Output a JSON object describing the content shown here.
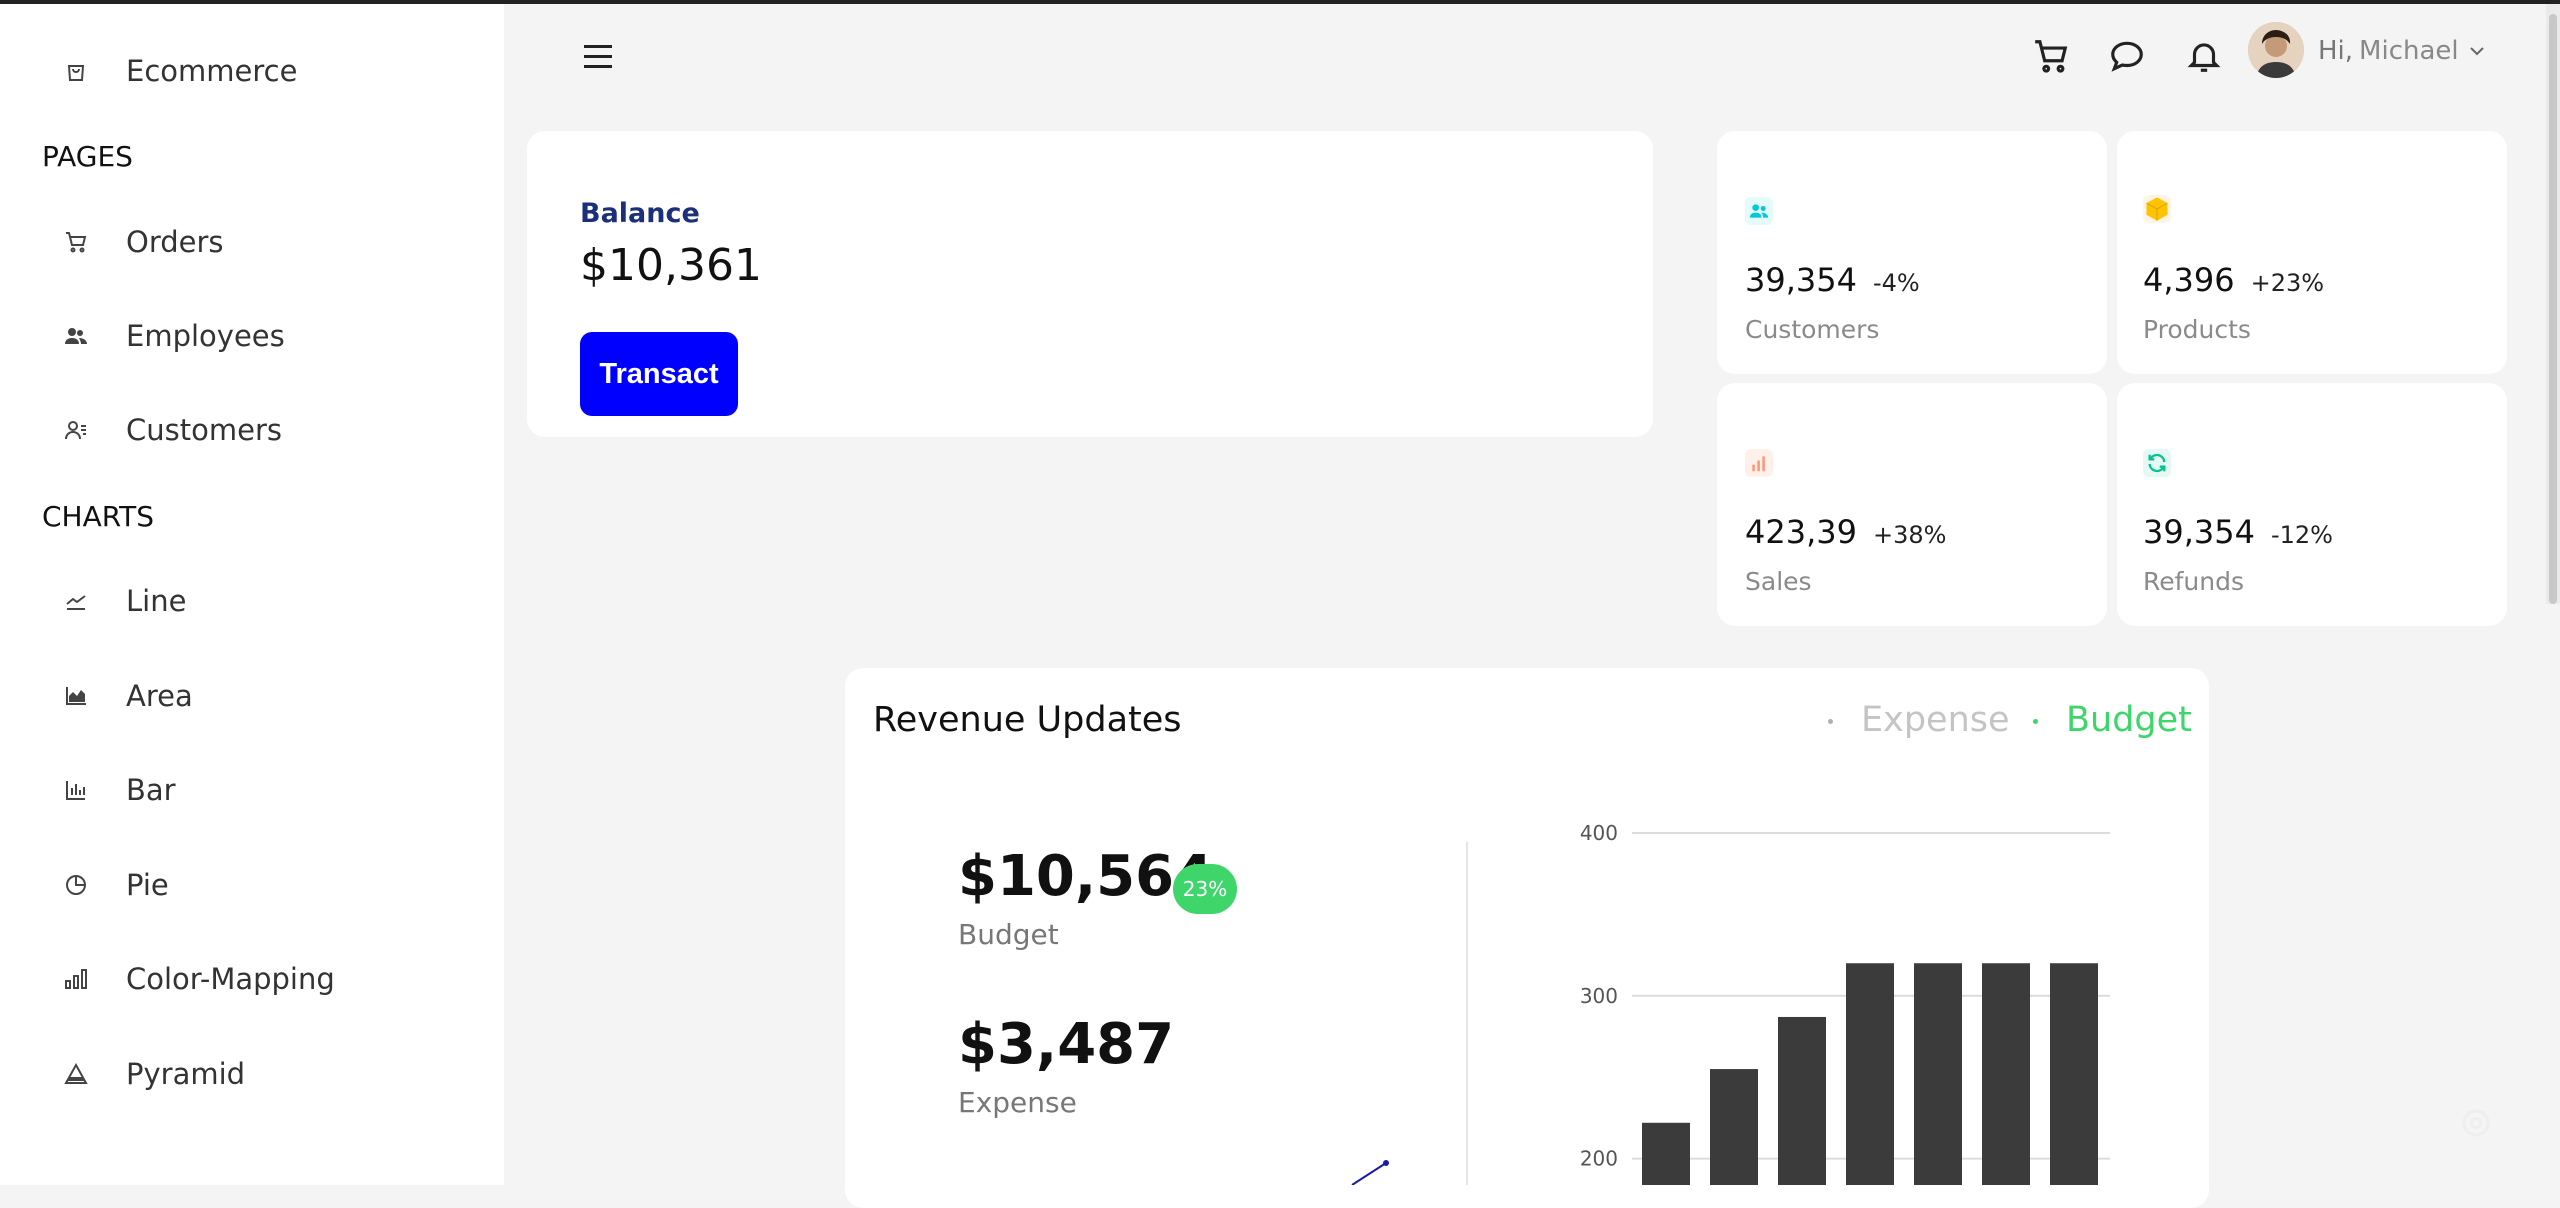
{
  "sidebar": {
    "top_item": {
      "label": "Ecommerce",
      "icon": "shopping-bag-icon"
    },
    "pages_heading": "PAGES",
    "pages": [
      {
        "label": "Orders",
        "icon": "cart-icon"
      },
      {
        "label": "Employees",
        "icon": "users-icon"
      },
      {
        "label": "Customers",
        "icon": "customers-icon"
      }
    ],
    "charts_heading": "CHARTS",
    "charts": [
      {
        "label": "Line",
        "icon": "line-chart-icon"
      },
      {
        "label": "Area",
        "icon": "area-chart-icon"
      },
      {
        "label": "Bar",
        "icon": "bar-chart-icon"
      },
      {
        "label": "Pie",
        "icon": "pie-chart-icon"
      },
      {
        "label": "Color-Mapping",
        "icon": "color-mapping-icon"
      },
      {
        "label": "Pyramid",
        "icon": "pyramid-icon"
      }
    ]
  },
  "topbar": {
    "greeting": "Hi,",
    "user_name": "Michael"
  },
  "balance": {
    "title": "Balance",
    "amount": "$10,361",
    "button": "Transact"
  },
  "stats": [
    {
      "value": "39,354",
      "change": "-4%",
      "label": "Customers",
      "icon": "customers-icon",
      "color": "#03c9d7"
    },
    {
      "value": "4,396",
      "change": "+23%",
      "label": "Products",
      "icon": "box-icon",
      "color": "#ffc300"
    },
    {
      "value": "423,39",
      "change": "+38%",
      "label": "Sales",
      "icon": "bar-chart-icon",
      "color": "#fb9678"
    },
    {
      "value": "39,354",
      "change": "-12%",
      "label": "Refunds",
      "icon": "refresh-icon",
      "color": "#00c292"
    }
  ],
  "revenue": {
    "title": "Revenue Updates",
    "legend_expense": "Expense",
    "legend_budget": "Budget",
    "budget_value": "$10,564",
    "budget_badge": "23%",
    "budget_label": "Budget",
    "expense_value": "$3,487",
    "expense_label": "Expense"
  },
  "colors": {
    "accent": "#0000ff",
    "budget_green": "#3ed66b",
    "expense_gray": "#c4c4c4",
    "bar": "#3b3b3b"
  },
  "chart_data": {
    "type": "bar",
    "y_ticks": [
      200,
      300,
      400
    ],
    "ylim": [
      100,
      400
    ],
    "values": [
      222,
      255,
      287,
      320,
      320,
      320,
      320
    ]
  }
}
